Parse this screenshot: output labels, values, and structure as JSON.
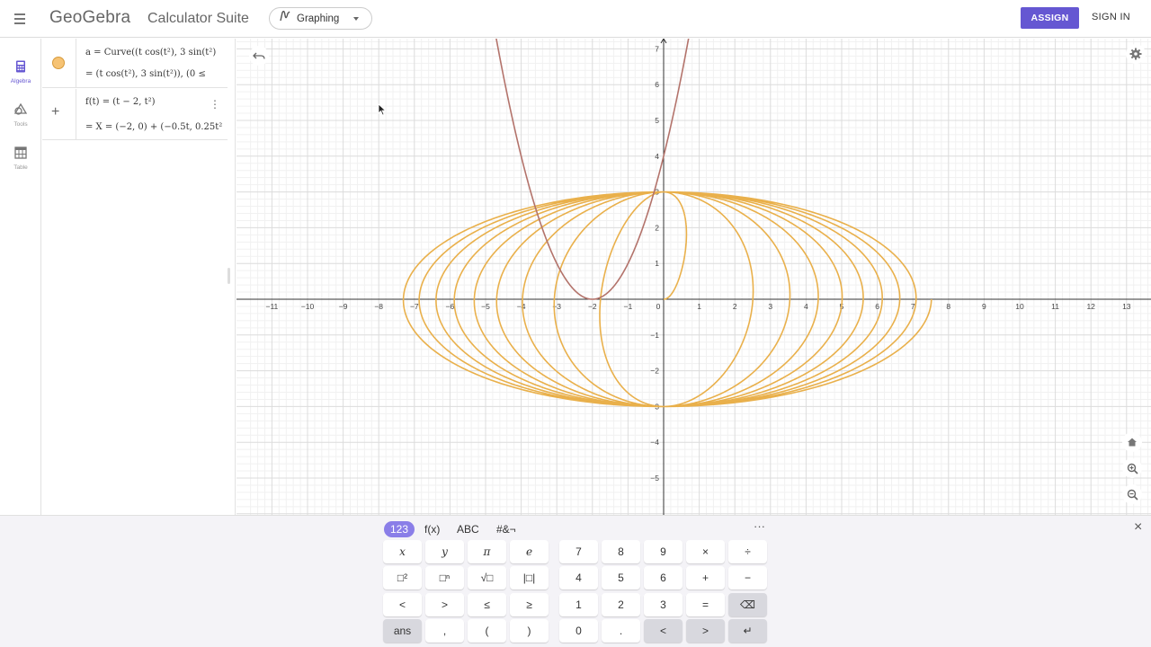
{
  "header": {
    "brand": "GeoGebra",
    "suite_title": "Calculator Suite",
    "app_picker_label": "Graphing",
    "assign_label": "ASSIGN",
    "signin_label": "SIGN IN"
  },
  "sidebar": {
    "items": [
      {
        "label": "Algebra",
        "icon": "calculator-icon"
      },
      {
        "label": "Tools",
        "icon": "shapes-icon"
      },
      {
        "label": "Table",
        "icon": "table-icon"
      }
    ]
  },
  "algebra": {
    "rows": [
      {
        "input": "a = Curve((t cos(t²), 3 sin(t²)",
        "output": "= (t cos(t²), 3 sin(t²)),   (0 ≤"
      },
      {
        "input": "f(t) = (t − 2, t²)",
        "output": "= X = (−2, 0) + (−0.5t, 0.25t²"
      }
    ]
  },
  "graph": {
    "x_ticks": [
      "−11",
      "−10",
      "−9",
      "−8",
      "−7",
      "−6",
      "−5",
      "−4",
      "−3",
      "−2",
      "−1",
      "0",
      "1",
      "2",
      "3",
      "4",
      "5",
      "6",
      "7",
      "8",
      "9",
      "10",
      "11",
      "12",
      "13"
    ],
    "y_ticks": [
      "7",
      "6",
      "5",
      "4",
      "3",
      "2",
      "1",
      "−1",
      "−2",
      "−3",
      "−4",
      "−5"
    ],
    "xlim": [
      -11.5,
      13.7
    ],
    "ylim": [
      -6,
      7.3
    ],
    "curve_color": "#e9b04b",
    "parabola_color": "#b3736b"
  },
  "keyboard": {
    "tabs": [
      "123",
      "f(x)",
      "ABC",
      "#&¬"
    ],
    "more": "···",
    "close": "×",
    "left_keys": [
      [
        "x",
        "y",
        "π",
        "e"
      ],
      [
        "□²",
        "□ⁿ",
        "√□",
        "|□|"
      ],
      [
        "<",
        ">",
        "≤",
        "≥"
      ],
      [
        "ans",
        ",",
        "(",
        ")"
      ]
    ],
    "right_keys": [
      [
        "7",
        "8",
        "9",
        "×",
        "÷"
      ],
      [
        "4",
        "5",
        "6",
        "+",
        "−"
      ],
      [
        "1",
        "2",
        "3",
        "=",
        "⌫"
      ],
      [
        "0",
        ".",
        "<",
        ">",
        "↵"
      ]
    ]
  }
}
